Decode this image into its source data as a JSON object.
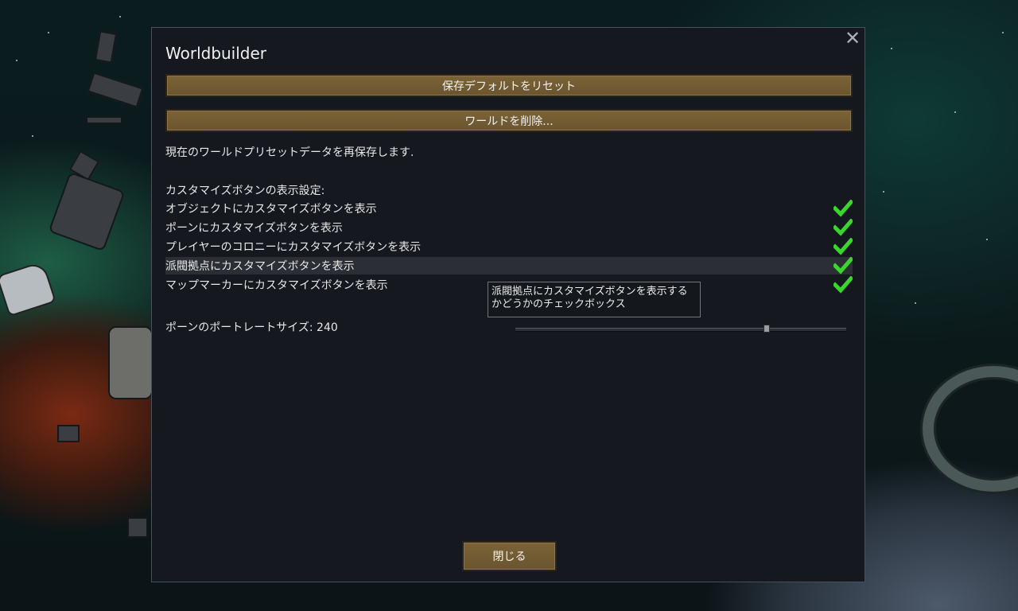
{
  "dialog": {
    "title": "Worldbuilder",
    "close_glyph": "✕",
    "reset_button": "保存デフォルトをリセット",
    "delete_button": "ワールドを削除...",
    "resave_text": "現在のワールドプリセットデータを再保存します.",
    "section_label": "カスタマイズボタンの表示設定:",
    "options": [
      {
        "label": "オブジェクトにカスタマイズボタンを表示",
        "checked": true
      },
      {
        "label": "ポーンにカスタマイズボタンを表示",
        "checked": true
      },
      {
        "label": "プレイヤーのコロニーにカスタマイズボタンを表示",
        "checked": true
      },
      {
        "label": "派閥拠点にカスタマイズボタンを表示",
        "checked": true
      },
      {
        "label": "マップマーカーにカスタマイズボタンを表示",
        "checked": true
      }
    ],
    "tooltip": "派閥拠点にカスタマイズボタンを表示するかどうかのチェックボックス",
    "portrait_label": "ポーンのポートレートサイズ: 240",
    "portrait_slider_fraction": 0.76,
    "close_button": "閉じる"
  },
  "colors": {
    "button_bg": "#6f5932",
    "check_green": "#3bd62c",
    "dialog_bg": "#15191f"
  },
  "icons": {
    "close": "close-icon",
    "check": "checkmark-icon"
  }
}
